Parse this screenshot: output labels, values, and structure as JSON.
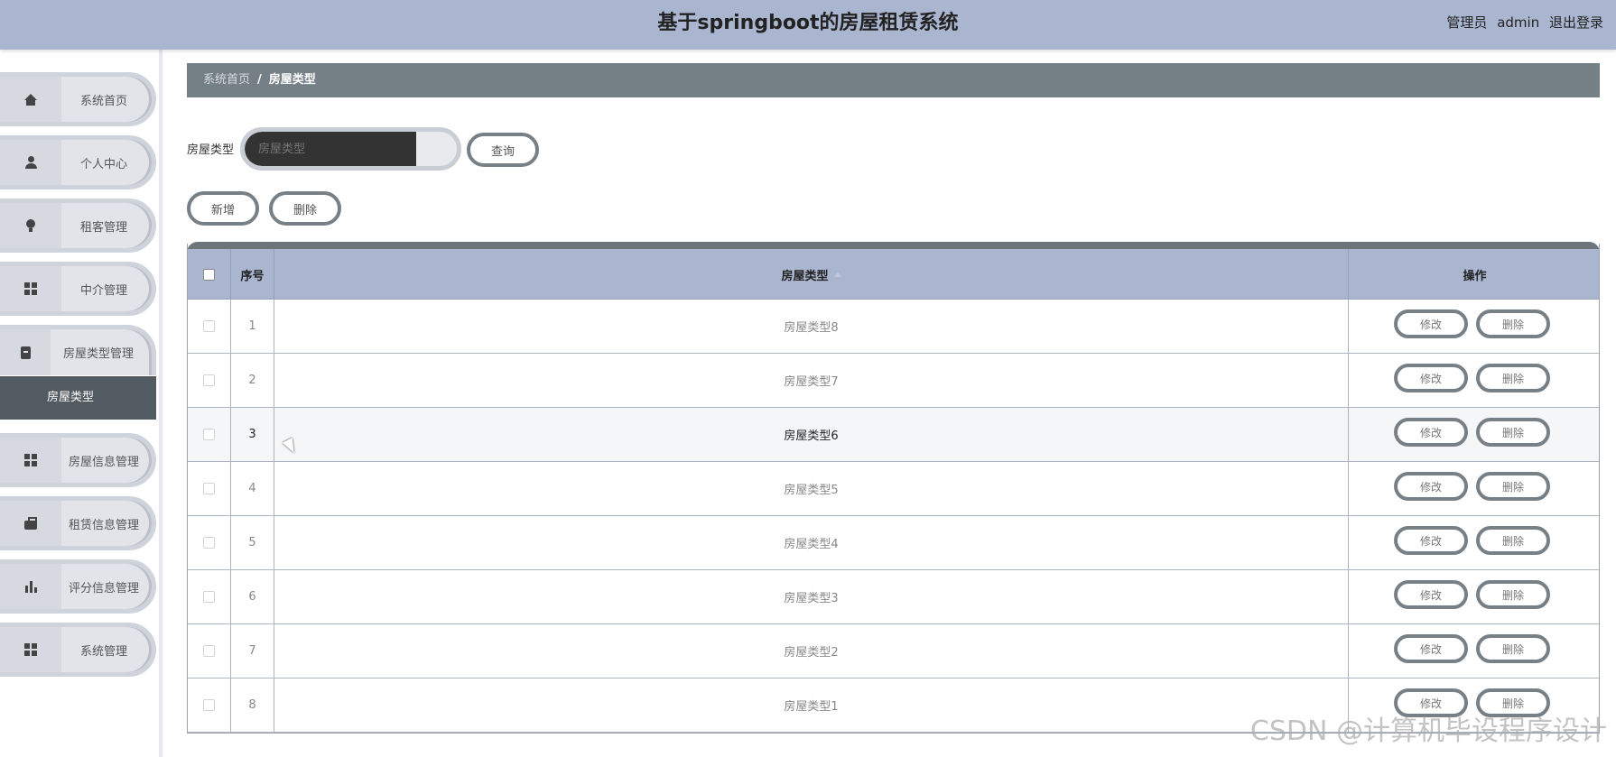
{
  "header": {
    "title": "基于springboot的房屋租赁系统",
    "role": "管理员",
    "username": "admin",
    "logout": "退出登录"
  },
  "sidebar": {
    "items": [
      {
        "label": "系统首页",
        "icon": "home-icon"
      },
      {
        "label": "个人中心",
        "icon": "user-icon"
      },
      {
        "label": "租客管理",
        "icon": "bulb-icon"
      },
      {
        "label": "中介管理",
        "icon": "grid-icon"
      },
      {
        "label": "房屋类型管理",
        "icon": "clipboard-icon",
        "sub": "房屋类型"
      },
      {
        "label": "房屋信息管理",
        "icon": "grid-icon"
      },
      {
        "label": "租赁信息管理",
        "icon": "briefcase-icon"
      },
      {
        "label": "评分信息管理",
        "icon": "bar-chart-icon"
      },
      {
        "label": "系统管理",
        "icon": "grid-icon"
      }
    ]
  },
  "breadcrumb": {
    "home": "系统首页",
    "sep": "/",
    "current": "房屋类型"
  },
  "search": {
    "label": "房屋类型",
    "placeholder": "房屋类型",
    "button": "查询"
  },
  "actions": {
    "add": "新增",
    "delete": "删除"
  },
  "table": {
    "headers": {
      "index": "序号",
      "type": "房屋类型",
      "ops": "操作"
    },
    "edit": "修改",
    "remove": "删除",
    "rows": [
      {
        "index": "1",
        "type": "房屋类型8"
      },
      {
        "index": "2",
        "type": "房屋类型7"
      },
      {
        "index": "3",
        "type": "房屋类型6"
      },
      {
        "index": "4",
        "type": "房屋类型5"
      },
      {
        "index": "5",
        "type": "房屋类型4"
      },
      {
        "index": "6",
        "type": "房屋类型3"
      },
      {
        "index": "7",
        "type": "房屋类型2"
      },
      {
        "index": "8",
        "type": "房屋类型1"
      }
    ]
  },
  "watermark": "CSDN @计算机毕设程序设计"
}
